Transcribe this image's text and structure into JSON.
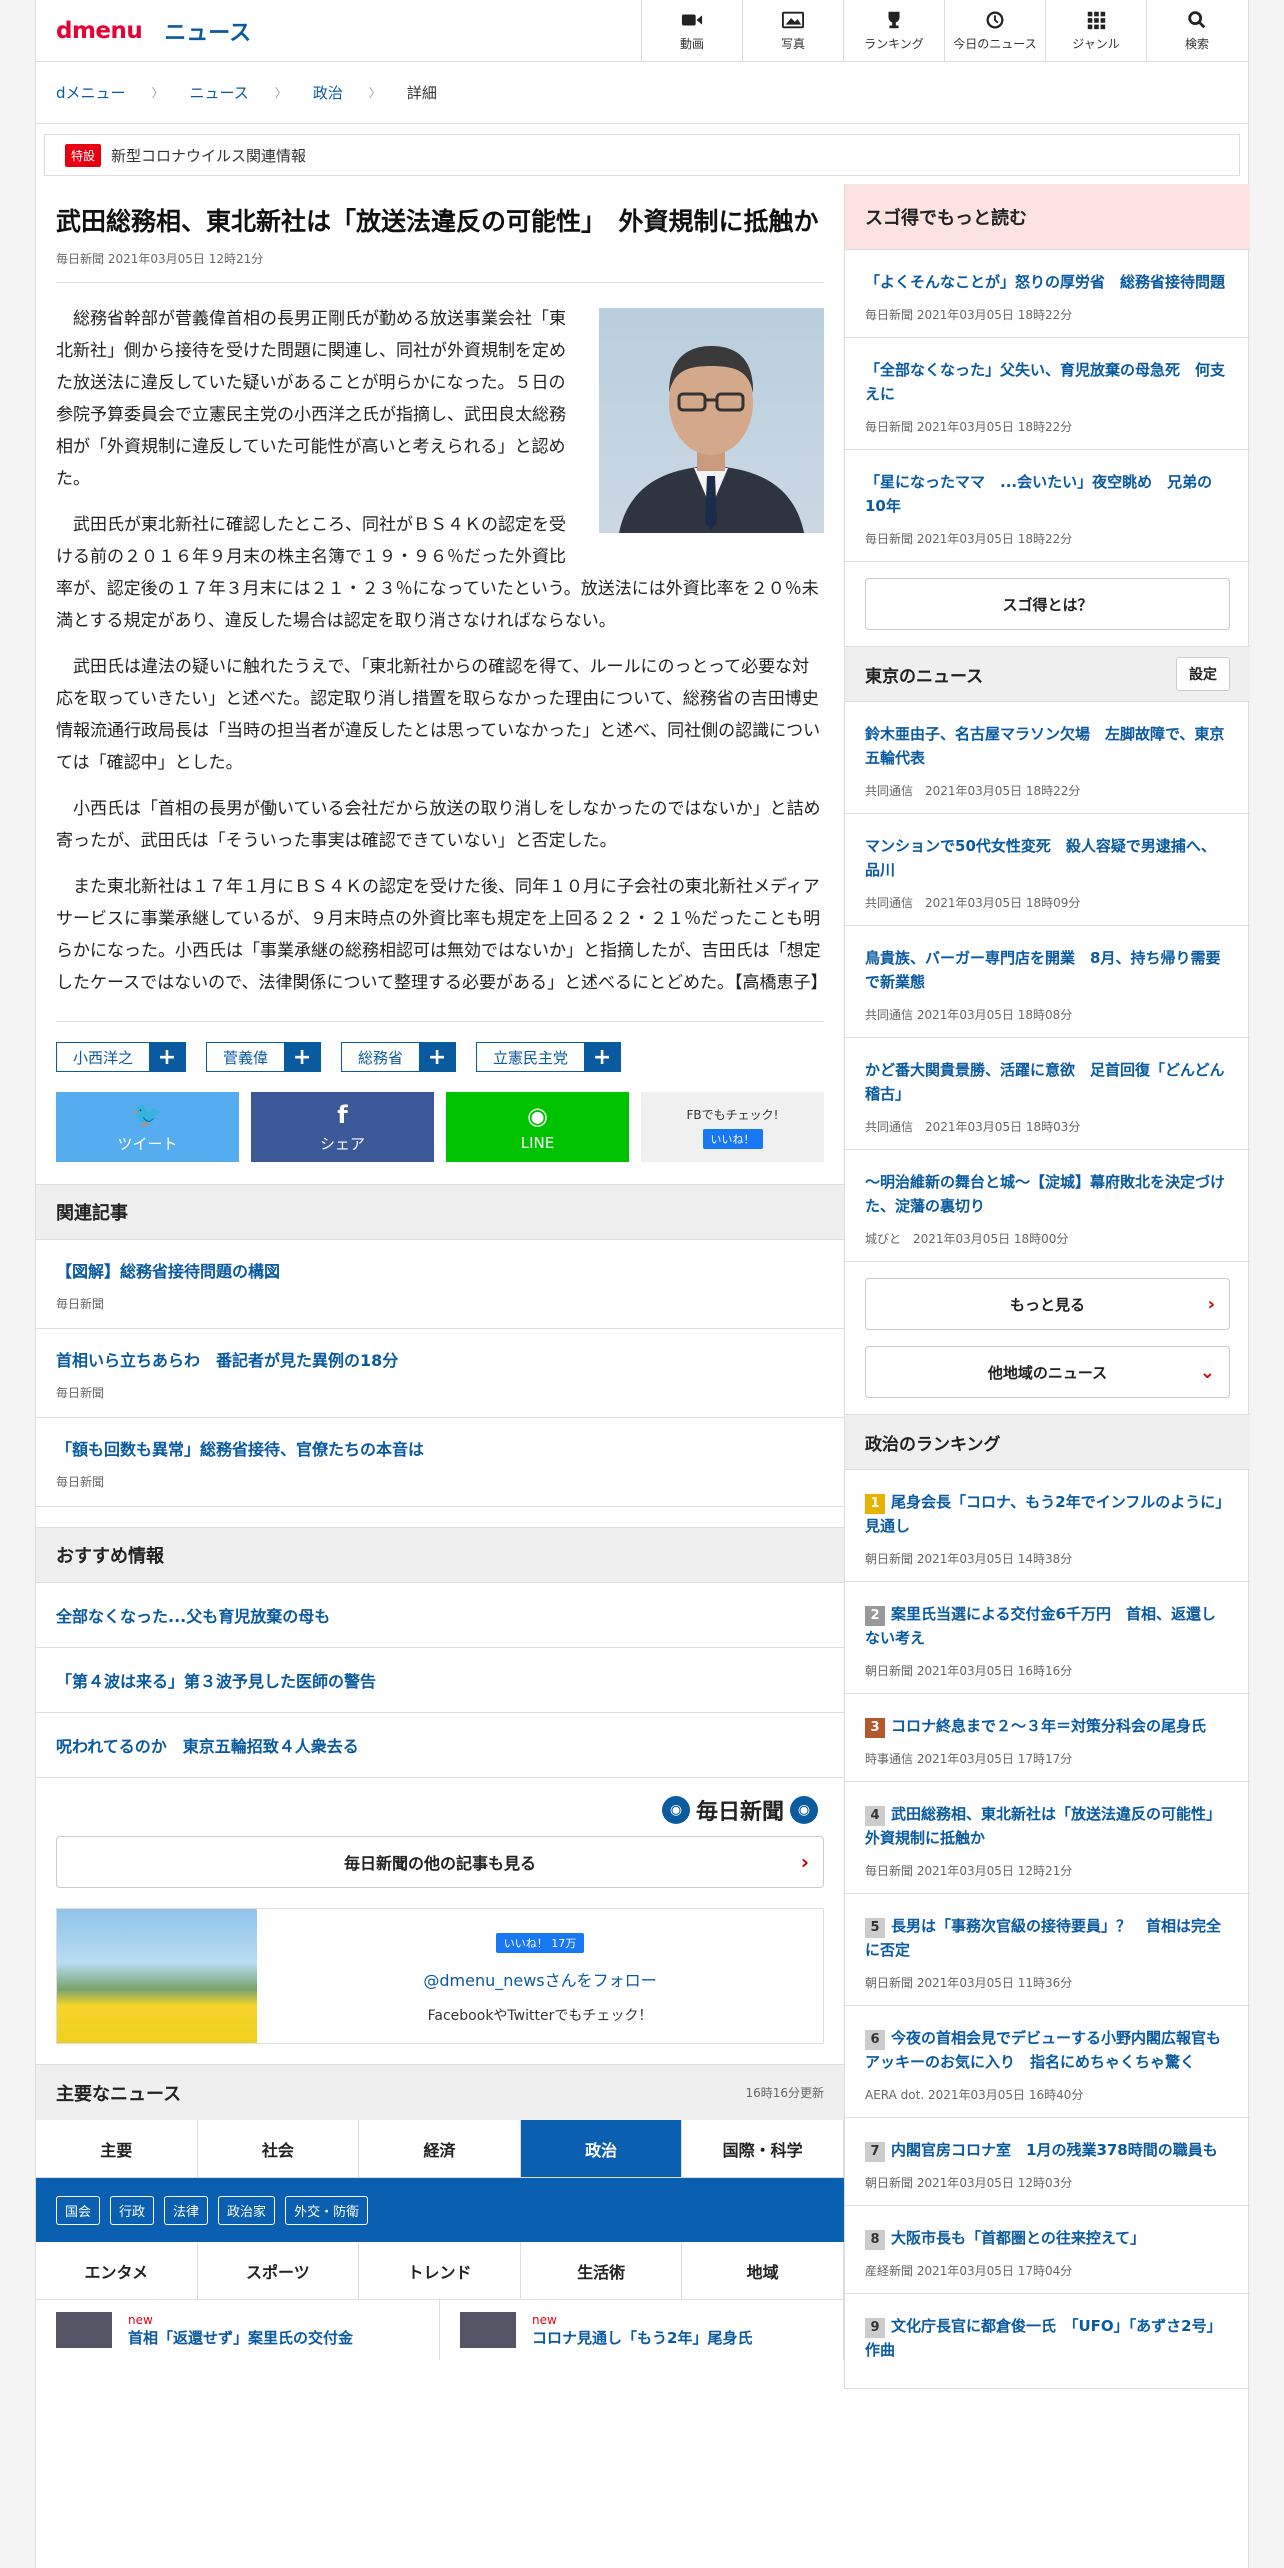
{
  "header": {
    "logo": "dmenu",
    "section": "ニュース",
    "nav": [
      {
        "label": "動画",
        "icon": "video-icon"
      },
      {
        "label": "写真",
        "icon": "photo-icon"
      },
      {
        "label": "ランキング",
        "icon": "trophy-icon"
      },
      {
        "label": "今日のニュース",
        "icon": "clock-icon"
      },
      {
        "label": "ジャンル",
        "icon": "grid-icon"
      },
      {
        "label": "検索",
        "icon": "search-icon"
      }
    ]
  },
  "breadcrumb": [
    "dメニュー",
    "ニュース",
    "政治",
    "詳細"
  ],
  "special": {
    "tag": "特設",
    "text": "新型コロナウイルス関連情報"
  },
  "article": {
    "title": "武田総務相、東北新社は「放送法違反の可能性」　外資規制に抵触か",
    "meta": "毎日新聞 2021年03月05日 12時21分",
    "paragraphs": [
      "総務省幹部が菅義偉首相の長男正剛氏が勤める放送事業会社「東北新社」側から接待を受けた問題に関連し、同社が外資規制を定めた放送法に違反していた疑いがあることが明らかになった。５日の参院予算委員会で立憲民主党の小西洋之氏が指摘し、武田良太総務相が「外資規制に違反していた可能性が高いと考えられる」と認めた。",
      "武田氏が東北新社に確認したところ、同社がＢＳ４Ｋの認定を受ける前の２０１６年９月末の株主名簿で１９・９６％だった外資比率が、認定後の１７年３月末には２１・２３％になっていたという。放送法には外資比率を２０％未満とする規定があり、違反した場合は認定を取り消さなければならない。",
      "武田氏は違法の疑いに触れたうえで、「東北新社からの確認を得て、ルールにのっとって必要な対応を取っていきたい」と述べた。認定取り消し措置を取らなかった理由について、総務省の吉田博史情報流通行政局長は「当時の担当者が違反したとは思っていなかった」と述べ、同社側の認識については「確認中」とした。",
      "小西氏は「首相の長男が働いている会社だから放送の取り消しをしなかったのではないか」と詰め寄ったが、武田氏は「そういった事実は確認できていない」と否定した。",
      "また東北新社は１７年１月にＢＳ４Ｋの認定を受けた後、同年１０月に子会社の東北新社メディアサービスに事業承継しているが、９月末時点の外資比率も規定を上回る２２・２１％だったことも明らかになった。小西氏は「事業承継の総務相認可は無効ではないか」と指摘したが、吉田氏は「想定したケースではないので、法律関係について整理する必要がある」と述べるにとどめた。【高橋恵子】"
    ],
    "tags": [
      "小西洋之",
      "菅義偉",
      "総務省",
      "立憲民主党"
    ],
    "share": {
      "tweet": "ツイート",
      "share": "シェア",
      "line": "LINE",
      "fb_check": "FBでもチェック!",
      "like": "いいね！"
    }
  },
  "related": {
    "heading": "関連記事",
    "items": [
      {
        "title": "【図解】総務省接待問題の構図",
        "source": "毎日新聞"
      },
      {
        "title": "首相いら立ちあらわ　番記者が見た異例の18分",
        "source": "毎日新聞"
      },
      {
        "title": "「額も回数も異常」総務省接待、官僚たちの本音は",
        "source": "毎日新聞"
      }
    ]
  },
  "recommend": {
    "heading": "おすすめ情報",
    "items": [
      "全部なくなった...父も育児放棄の母も",
      "「第４波は来る」第３波予見した医師の警告",
      "呪われてるのか　東京五輪招致４人衆去る"
    ]
  },
  "mainichi": {
    "logo": "毎日新聞",
    "more": "毎日新聞の他の記事も見る"
  },
  "follow": {
    "like": "いいね！ 17万",
    "handle": "@dmenu_newsさんをフォロー",
    "note": "FacebookやTwitterでもチェック！"
  },
  "major": {
    "heading": "主要なニュース",
    "updated": "16時16分更新",
    "tabs1": [
      "主要",
      "社会",
      "経済",
      "政治",
      "国際・科学"
    ],
    "subtags": [
      "国会",
      "行政",
      "法律",
      "政治家",
      "外交・防衛"
    ],
    "tabs2": [
      "エンタメ",
      "スポーツ",
      "トレンド",
      "生活術",
      "地域"
    ],
    "items": [
      {
        "new": "new",
        "title": "首相「返還せず」案里氏の交付金"
      },
      {
        "new": "new",
        "title": "コロナ見通し「もう2年」尾身氏"
      }
    ]
  },
  "sidebar": {
    "sugotoku_heading": "スゴ得でもっと読む",
    "sugotoku": [
      {
        "title": "「よくそんなことが」怒りの厚労省　総務省接待問題",
        "source": "毎日新聞 2021年03月05日 18時22分"
      },
      {
        "title": "「全部なくなった」父失い、育児放棄の母急死　何支えに",
        "source": "毎日新聞 2021年03月05日 18時22分"
      },
      {
        "title": "「星になったママ　...会いたい」夜空眺め　兄弟の10年",
        "source": "毎日新聞 2021年03月05日 18時22分"
      }
    ],
    "sugotoku_btn": "スゴ得とは？",
    "tokyo_heading": "東京のニュース",
    "settings": "設定",
    "tokyo": [
      {
        "title": "鈴木亜由子、名古屋マラソン欠場　左脚故障で、東京五輪代表",
        "source": "共同通信　2021年03月05日 18時22分"
      },
      {
        "title": "マンションで50代女性変死　殺人容疑で男逮捕へ、品川",
        "source": "共同通信　2021年03月05日 18時09分"
      },
      {
        "title": "鳥貴族、バーガー専門店を開業　8月、持ち帰り需要で新業態",
        "source": "共同通信 2021年03月05日 18時08分"
      },
      {
        "title": "かど番大関貴景勝、活躍に意欲　足首回復「どんどん稽古」",
        "source": "共同通信　2021年03月05日 18時03分"
      },
      {
        "title": "〜明治維新の舞台と城〜【淀城】幕府敗北を決定づけた、淀藩の裏切り",
        "source": "城びと　2021年03月05日 18時00分"
      }
    ],
    "more": "もっと見る",
    "other": "他地域のニュース",
    "ranking_heading": "政治のランキング",
    "ranking": [
      {
        "rank": "1",
        "title": "尾身会長「コロナ、もう2年でインフルのように」見通し",
        "source": "朝日新聞 2021年03月05日 14時38分"
      },
      {
        "rank": "2",
        "title": "案里氏当選による交付金6千万円　首相、返還しない考え",
        "source": "朝日新聞 2021年03月05日 16時16分"
      },
      {
        "rank": "3",
        "title": "コロナ終息まで２〜３年＝対策分科会の尾身氏",
        "source": "時事通信 2021年03月05日 17時17分"
      },
      {
        "rank": "4",
        "title": "武田総務相、東北新社は「放送法違反の可能性」　外資規制に抵触か",
        "source": "毎日新聞 2021年03月05日 12時21分"
      },
      {
        "rank": "5",
        "title": "長男は「事務次官級の接待要員」？　首相は完全に否定",
        "source": "朝日新聞 2021年03月05日 11時36分"
      },
      {
        "rank": "6",
        "title": "今夜の首相会見でデビューする小野内閣広報官もアッキーのお気に入り　指名にめちゃくちゃ驚く",
        "source": "AERA dot. 2021年03月05日 16時40分"
      },
      {
        "rank": "7",
        "title": "内閣官房コロナ室　1月の残業378時間の職員も",
        "source": "朝日新聞 2021年03月05日 12時03分"
      },
      {
        "rank": "8",
        "title": "大阪市長も「首都圏との往来控えて」",
        "source": "産経新聞 2021年03月05日 17時04分"
      },
      {
        "rank": "9",
        "title": "文化庁長官に都倉俊一氏　「UFO」「あずさ2号」作曲",
        "source": ""
      }
    ]
  }
}
